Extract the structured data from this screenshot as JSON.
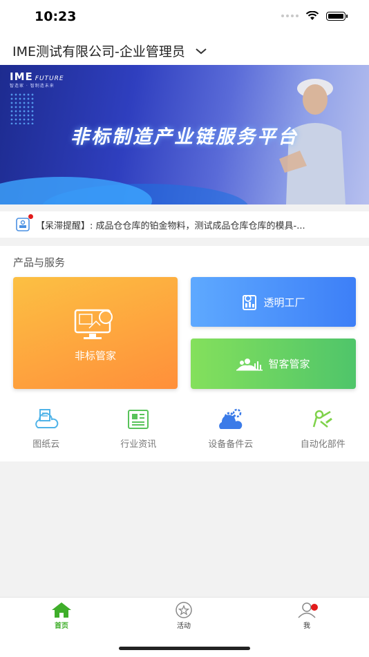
{
  "status_bar": {
    "time": "10:23"
  },
  "header": {
    "company": "IME测试有限公司-企业管理员"
  },
  "banner": {
    "logo": "IME",
    "logo_suffix": "FUTURE",
    "slogan": "智造家 · 智制造未来",
    "title": "非标制造产业链服务平台"
  },
  "notice": {
    "text": "【呆滞提醒】: 成品仓仓库的铂金物料，测试成品仓库仓库的模具-..."
  },
  "services": {
    "section_title": "产品与服务",
    "cards": {
      "nonstandard": "非标管家",
      "transparent_factory": "透明工厂",
      "smart_customer": "智客管家"
    },
    "apps": [
      {
        "label": "图纸云",
        "icon": "drawing-cloud-icon",
        "color": "#4fb3e8"
      },
      {
        "label": "行业资讯",
        "icon": "news-icon",
        "color": "#58c35a"
      },
      {
        "label": "设备备件云",
        "icon": "equipment-cloud-icon",
        "color": "#3b7be8"
      },
      {
        "label": "自动化部件",
        "icon": "automation-parts-icon",
        "color": "#7fd24a"
      }
    ]
  },
  "tabbar": {
    "tabs": [
      {
        "label": "首页",
        "active": true
      },
      {
        "label": "活动",
        "active": false
      },
      {
        "label": "我",
        "active": false
      }
    ],
    "accent": "#3fae2a"
  }
}
